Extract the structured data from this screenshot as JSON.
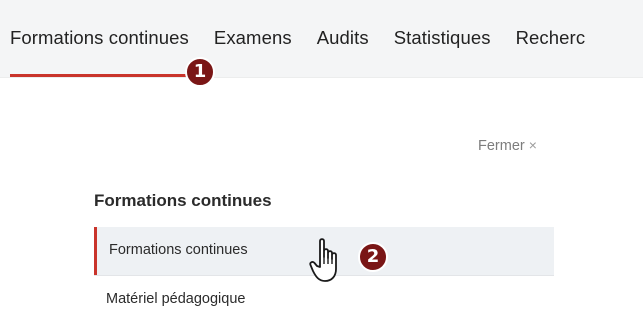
{
  "nav": {
    "tabs": [
      {
        "label": "Formations continues"
      },
      {
        "label": "Examens"
      },
      {
        "label": "Audits"
      },
      {
        "label": "Statistiques"
      },
      {
        "label": "Recherc"
      }
    ]
  },
  "callouts": {
    "first": "1",
    "second": "2"
  },
  "close": {
    "label": "Fermer",
    "icon_glyph": "×"
  },
  "section": {
    "title": "Formations continues",
    "items": [
      {
        "label": "Formations continues"
      },
      {
        "label": "Matériel pédagogique"
      }
    ]
  },
  "colors": {
    "accent": "#c9342b",
    "badge": "#7a1616",
    "nav_background": "#f4f5f6",
    "selected_background": "#eef1f4"
  },
  "icons": {
    "cursor": "hand-pointer-icon",
    "close": "close-icon"
  }
}
